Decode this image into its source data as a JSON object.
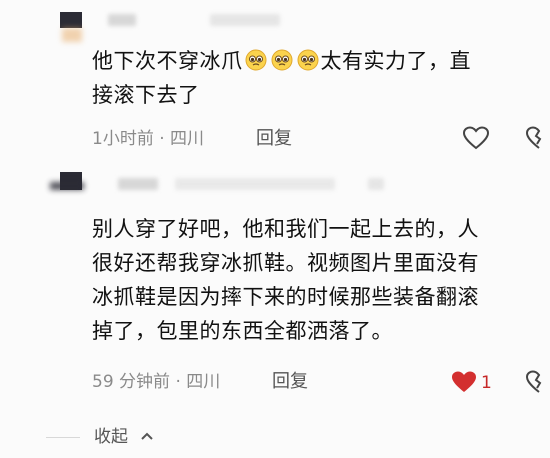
{
  "comments": [
    {
      "text_before_emoji": "他下次不穿冰爪",
      "emoji": [
        "pleading-face-emoji",
        "pleading-face-emoji",
        "pleading-face-emoji"
      ],
      "text_after_emoji_line1": "太有实力了，直",
      "text_line2": "接滚下去了",
      "meta": "1小时前 · 四川",
      "reply_label": "回复",
      "like_icon": "heart-outline-icon",
      "dislike_icon": "broken-heart-icon"
    },
    {
      "lines": [
        "别人穿了好吧，他和我们一起上去的，人",
        "很好还帮我穿冰抓鞋。视频图片里面没有",
        "冰抓鞋是因为摔下来的时候那些装备翻滚",
        "掉了，包里的东西全都洒落了。"
      ],
      "meta": "59 分钟前 · 四川",
      "reply_label": "回复",
      "like_icon": "heart-filled-icon",
      "like_count": "1",
      "like_color": "#d32f2f",
      "dislike_icon": "broken-heart-icon"
    }
  ],
  "collapse": {
    "label": "收起",
    "icon": "chevron-up-icon"
  }
}
